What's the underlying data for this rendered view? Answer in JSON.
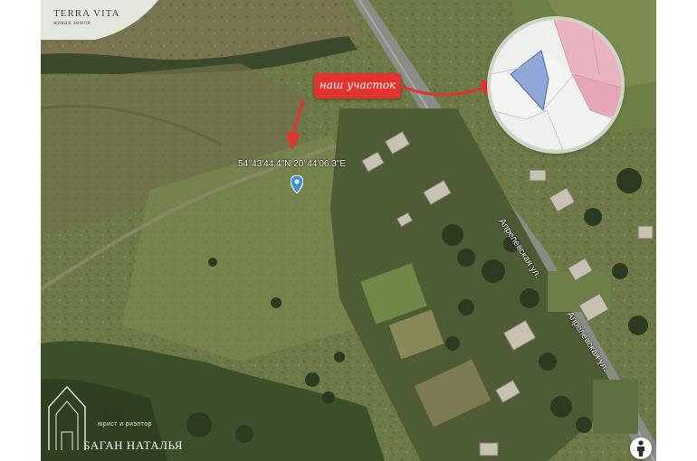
{
  "brand": {
    "title": "TERRA VITA",
    "subtitle": "живая земля"
  },
  "callout": {
    "label": "наш участок",
    "color": "#e4322e"
  },
  "pin": {
    "coordinates": "54°43'44.4\"N 20°44'06.3\"E",
    "icon": "map-pin-icon",
    "color": "#3f8ed6"
  },
  "streets": [
    {
      "name": "Апрелевская ул."
    },
    {
      "name": "Апрелевская ул."
    }
  ],
  "inset": {
    "plot_color": "#8fa8d8",
    "neighbor_color": "#e9b4c0"
  },
  "agent": {
    "role": "юрист и риэлтор",
    "name": "БАГАН НАТАЛЬЯ"
  },
  "controls": {
    "street_view_icon": "pegman-icon"
  }
}
